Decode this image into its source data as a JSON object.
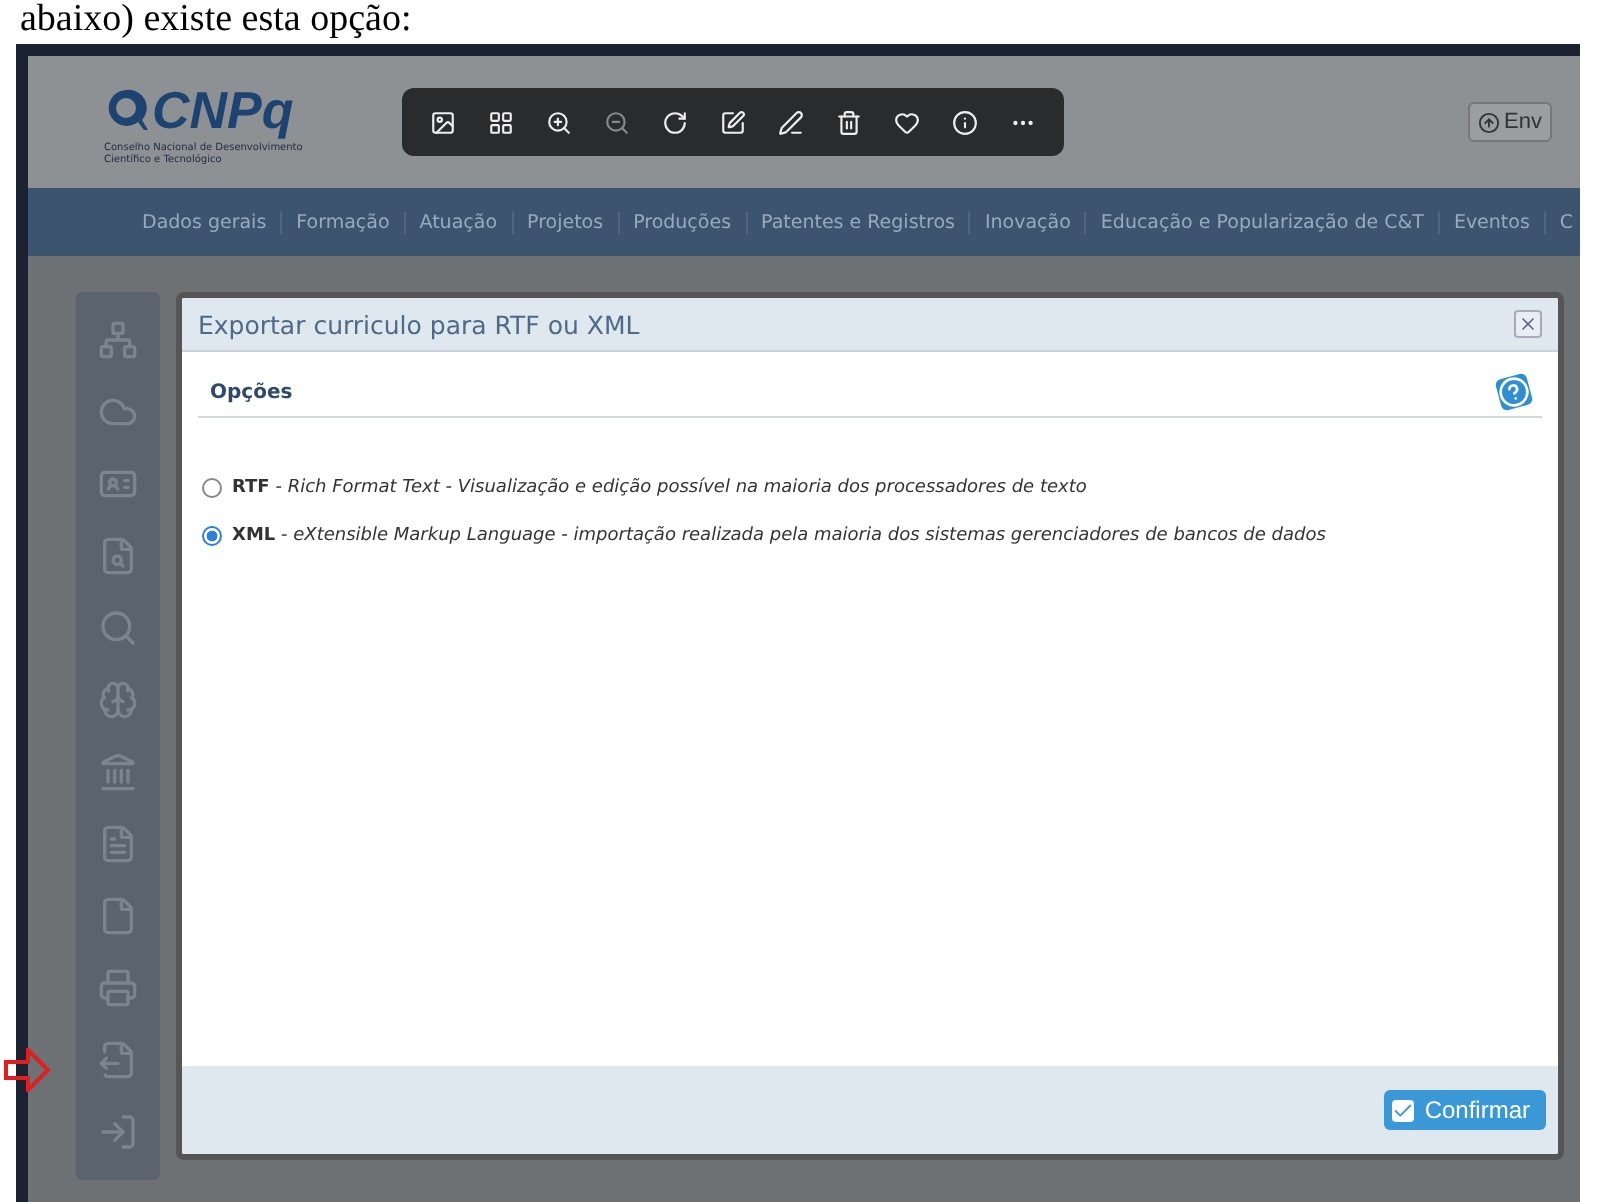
{
  "caption": "abaixo) existe esta opção:",
  "header": {
    "logo": "CNPq",
    "subtitle_lines": [
      "Conselho Nacional de Desenvolvimento",
      "Científico e Tecnológico"
    ],
    "button": "Env"
  },
  "nav": [
    "Dados gerais",
    "Formação",
    "Atuação",
    "Projetos",
    "Produções",
    "Patentes e Registros",
    "Inovação",
    "Educação e Popularização de C&T",
    "Eventos",
    "C"
  ],
  "dialog": {
    "title": "Exportar curriculo para RTF ou XML",
    "section": "Opções",
    "options": [
      {
        "text": "**RTF** - *Rich Format Text - Visualização e edição possível na maioria dos processadores de texto*",
        "selected": false
      },
      {
        "text": "**XML** - *eXtensible Markup Language - importação realizada pela maioria dos sistemas gerenciadores de bancos de dados*",
        "selected": true
      }
    ],
    "confirm": "Confirmar"
  }
}
